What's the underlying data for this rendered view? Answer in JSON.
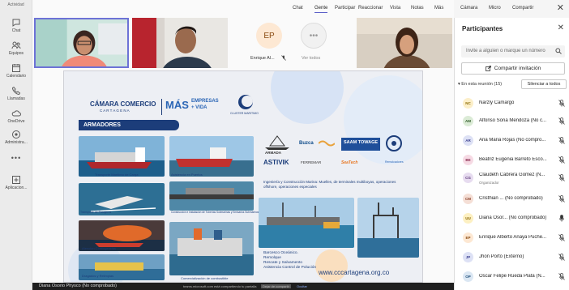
{
  "rail": {
    "top_label": "Actividad",
    "items": [
      {
        "label": "Chat",
        "icon": "chat-icon"
      },
      {
        "label": "Equipos",
        "icon": "teams-icon"
      },
      {
        "label": "Calendario",
        "icon": "calendar-icon"
      },
      {
        "label": "Llamadas",
        "icon": "phone-icon"
      },
      {
        "label": "OneDrive",
        "icon": "cloud-icon"
      },
      {
        "label": "Administra...",
        "icon": "apps-icon"
      }
    ],
    "more": "•••",
    "apps_label": "Aplicacion..."
  },
  "toolbar": {
    "items": [
      "Chat",
      "Gente",
      "Participar",
      "Reaccionar",
      "Vista",
      "Notas",
      "Más",
      "Cámara",
      "Micro",
      "Compartir"
    ],
    "active": "Gente",
    "close": "✕"
  },
  "tiles": [
    {
      "name": "",
      "kind": "video"
    },
    {
      "name": "",
      "kind": "video"
    },
    {
      "name": "Enrique Al...",
      "kind": "avatar",
      "initials": "EP"
    },
    {
      "name": "Ver todos",
      "kind": "more",
      "initials": "•••"
    },
    {
      "name": "",
      "kind": "video"
    }
  ],
  "share_footer": {
    "presenter": "Diana Osorio Physco (No comprobado)",
    "note": "teams.microsoft.com está compartiendo tu pantalla",
    "stop": "Dejar de compartir",
    "hide": "Ocultar"
  },
  "poster": {
    "org_top": "CÁMARA COMERCIO",
    "org_city": "C A R T A G E N A",
    "mas": "MÁS",
    "mas_sub": "EMPRESAS",
    "mas_sub2": "+ VIDA",
    "cluster": "CLUSTER MARITIMO",
    "section": "ARMADORES",
    "photo_labels": [
      "Transporte Marítimo de Carga",
      "Asistencia en Puertos",
      "Transporte de Pasajeros",
      "Construcción e Instalación de Tuberías Submarinas y Emisarios Submarinos",
      "Atención Contingencias",
      "Comercialización de combustible",
      "Dragados y Relimpias"
    ],
    "logos": [
      "ARMADA",
      "Buzca",
      "SAAM TOWAGE",
      "ASTIVIK",
      "FERREMAR",
      "SeaTech",
      "Remolcadores"
    ],
    "service_text": "Ingeniería y Construcción Marina: Muelles, de terminales multiboyas, operaciones offshore, operaciones especiales",
    "services": [
      "Barcesco Oceánico.",
      "Remolque",
      "Rescate y Salvamento",
      "Asistencia Control de Polución"
    ],
    "url": "www.cccartagena.org.co"
  },
  "panel": {
    "title": "Participantes",
    "search_placeholder": "Invite a alguien o marque un número",
    "share_button": "Compartir invitación",
    "section": "En esta reunión (15)",
    "mute_all": "Silenciar a todos",
    "participants": [
      {
        "initials": "NC",
        "name": "Narzly Camargo",
        "sub": "",
        "bg": "#fcefc9",
        "fg": "#8a6a00",
        "mic": "muted"
      },
      {
        "initials": "AM",
        "name": "Alfonso Soria Mendoza (No c...",
        "sub": "",
        "bg": "#dbebd6",
        "fg": "#2d5a26",
        "mic": "muted"
      },
      {
        "initials": "AR",
        "name": "Ana Maria Rojas (No compro...",
        "sub": "",
        "bg": "#dde1f5",
        "fg": "#3b3f8f",
        "mic": "muted"
      },
      {
        "initials": "BE",
        "name": "Beatriz Eugenia Barreto Esco...",
        "sub": "",
        "bg": "#f6dae4",
        "fg": "#8a2a4f",
        "mic": "muted"
      },
      {
        "initials": "CG",
        "name": "Claudeth Cabrera Gomez (N...",
        "sub": "Organizador",
        "bg": "#e7dcf0",
        "fg": "#5d3a7a",
        "mic": "muted"
      },
      {
        "initials": "CM",
        "name": "Cristhian ... (No comprobado)",
        "sub": "",
        "bg": "#f5dfd6",
        "fg": "#8a3e25",
        "mic": "muted"
      },
      {
        "initials": "UU",
        "name": "Diana Osor... (No comprobado)",
        "sub": "",
        "bg": "#fdf0c2",
        "fg": "#866300",
        "mic": "on"
      },
      {
        "initials": "EP",
        "name": "Enrique Alberto Anaya Puche...",
        "sub": "",
        "bg": "#fde8d3",
        "fg": "#8a4b12",
        "mic": "muted"
      },
      {
        "initials": "JP",
        "name": "Jhon Porto (Externo)",
        "sub": "",
        "bg": "#dde1f5",
        "fg": "#3b3f8f",
        "mic": "muted"
      },
      {
        "initials": "OP",
        "name": "Oscar Felipe Rueda Plata (N...",
        "sub": "",
        "bg": "#dbe7f3",
        "fg": "#1f4e79",
        "mic": "muted"
      }
    ]
  },
  "colors": {
    "accent": "#5b5fc7",
    "brand_blue": "#1c3d7a"
  }
}
